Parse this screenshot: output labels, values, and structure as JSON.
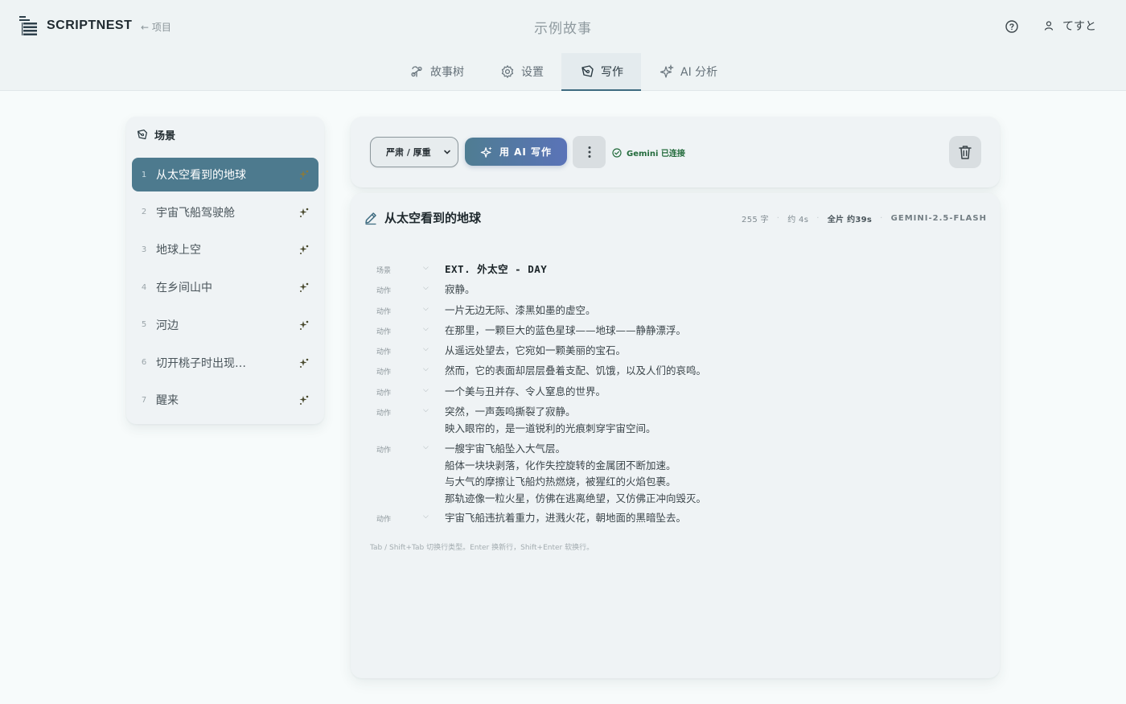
{
  "app": {
    "name": "SCRIPTNEST",
    "back_label": "← 项目",
    "story_title": "示例故事"
  },
  "user": {
    "name": "てすと"
  },
  "tabs": [
    {
      "label": "故事树",
      "icon": "tree-icon"
    },
    {
      "label": "设置",
      "icon": "gear-icon"
    },
    {
      "label": "写作",
      "icon": "pen-icon",
      "active": true
    },
    {
      "label": "AI 分析",
      "icon": "sparkle-icon"
    }
  ],
  "scenes": {
    "title": "场景",
    "items": [
      {
        "num": "1",
        "label": "从太空看到的地球",
        "active": true
      },
      {
        "num": "2",
        "label": "宇宙飞船驾驶舱"
      },
      {
        "num": "3",
        "label": "地球上空"
      },
      {
        "num": "4",
        "label": "在乡间山中"
      },
      {
        "num": "5",
        "label": "河边"
      },
      {
        "num": "6",
        "label": "切开桃子时出现…"
      },
      {
        "num": "7",
        "label": "醒来"
      }
    ]
  },
  "toolbar": {
    "tone_selected": "严肃 / 厚重",
    "ai_write_label": "用 AI 写作",
    "status_label": "Gemini 已连接"
  },
  "editor": {
    "title": "从太空看到的地球",
    "char_count": "255 字",
    "duration": "约 4s",
    "full_duration": "全片 约39s",
    "model": "GEMINI-2.5-FLASH",
    "lines": [
      {
        "type": "场景",
        "text": "EXT. 外太空 - DAY",
        "heading": true
      },
      {
        "type": "动作",
        "text": "寂静。"
      },
      {
        "type": "动作",
        "text": "一片无边无际、漆黑如墨的虚空。"
      },
      {
        "type": "动作",
        "text": "在那里，一颗巨大的蓝色星球——地球——静静漂浮。"
      },
      {
        "type": "动作",
        "text": "从遥远处望去，它宛如一颗美丽的宝石。"
      },
      {
        "type": "动作",
        "text": "然而，它的表面却层层叠着支配、饥饿，以及人们的哀鸣。"
      },
      {
        "type": "动作",
        "text": "一个美与丑并存、令人窒息的世界。"
      },
      {
        "type": "动作",
        "text": "突然，一声轰鸣撕裂了寂静。\n映入眼帘的，是一道锐利的光痕刺穿宇宙空间。"
      },
      {
        "type": "动作",
        "text": "一艘宇宙飞船坠入大气层。\n船体一块块剥落，化作失控旋转的金属团不断加速。\n与大气的摩擦让飞船灼热燃烧，被猩红的火焰包裹。\n那轨迹像一粒火星，仿佛在逃离绝望，又仿佛正冲向毁灭。"
      },
      {
        "type": "动作",
        "text": "宇宙飞船违抗着重力，进溅火花，朝地面的黑暗坠去。"
      }
    ],
    "hint": "Tab / Shift+Tab 切换行类型。Enter 换新行，Shift+Enter 软换行。"
  },
  "colors": {
    "accent": "#4d7a8e",
    "status_green": "#236b3c",
    "button_gradient_end": "#5a73b8"
  }
}
